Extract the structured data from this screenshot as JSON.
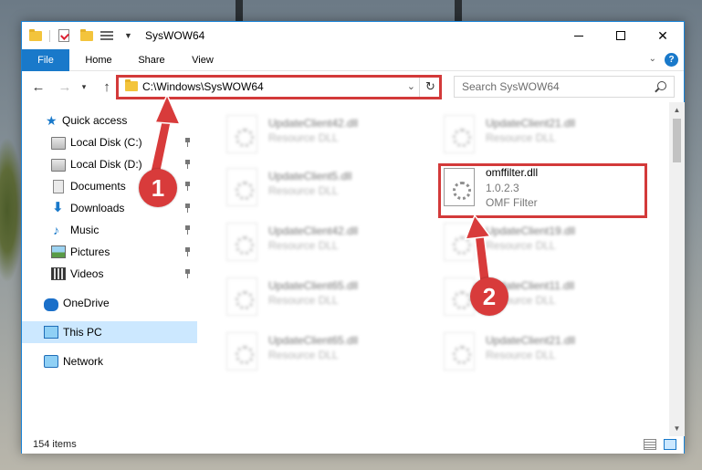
{
  "window": {
    "title": "SysWOW64",
    "close_glyph": "✕"
  },
  "ribbon": {
    "tabs": [
      "File",
      "Home",
      "Share",
      "View"
    ],
    "help_glyph": "?"
  },
  "navigation": {
    "address": "C:\\Windows\\SysWOW64",
    "search_placeholder": "Search SysWOW64"
  },
  "sidebar": {
    "items": [
      {
        "label": "Quick access"
      },
      {
        "label": "Local Disk (C:)"
      },
      {
        "label": "Local Disk (D:)"
      },
      {
        "label": "Documents"
      },
      {
        "label": "Downloads"
      },
      {
        "label": "Music"
      },
      {
        "label": "Pictures"
      },
      {
        "label": "Videos"
      },
      {
        "label": "OneDrive"
      },
      {
        "label": "This PC"
      },
      {
        "label": "Network"
      }
    ]
  },
  "files": [
    {
      "name": "UpdateClient42.dll",
      "desc": "Resource DLL"
    },
    {
      "name": "UpdateClient21.dll",
      "desc": "Resource DLL"
    },
    {
      "name": "UpdateClient5.dll",
      "desc": "Resource DLL"
    },
    {
      "name": "omffilter.dll",
      "version": "1.0.2.3",
      "desc": "OMF Filter"
    },
    {
      "name": "UpdateClient42.dll",
      "desc": "Resource DLL"
    },
    {
      "name": "UpdateClient19.dll",
      "desc": "Resource DLL"
    },
    {
      "name": "UpdateClient65.dll",
      "desc": "Resource DLL"
    },
    {
      "name": "UpdateClient11.dll",
      "desc": "Resource DLL"
    },
    {
      "name": "UpdateClient65.dll",
      "desc": "Resource DLL"
    },
    {
      "name": "UpdateClient21.dll",
      "desc": "Resource DLL"
    }
  ],
  "status": {
    "item_count": "154 items"
  },
  "callouts": {
    "one": "1",
    "two": "2"
  },
  "colors": {
    "accent": "#1979ca",
    "highlight": "#d33a3a",
    "selected": "#cce8ff"
  }
}
